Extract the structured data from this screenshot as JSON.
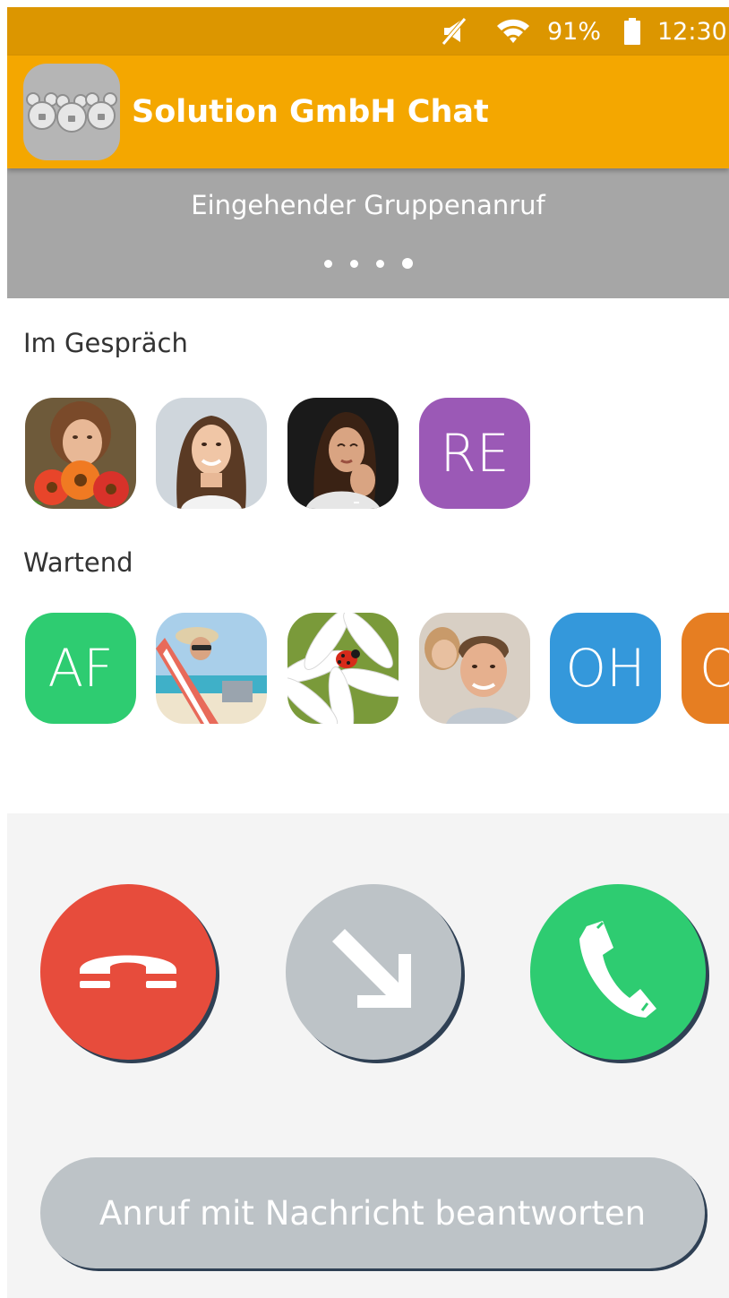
{
  "status_bar": {
    "battery": "91%",
    "time": "12:30",
    "icons": [
      "mute-icon",
      "wifi-icon",
      "battery-icon"
    ]
  },
  "app_bar": {
    "title": "Solution GmbH Chat",
    "logo_icon": "app-logo-icon"
  },
  "call": {
    "status": "Eingehender Gruppenanruf",
    "dots": 4
  },
  "in_call": {
    "label": "Im Gespräch",
    "participants": [
      {
        "type": "photo",
        "icon": "woman-with-flowers-photo"
      },
      {
        "type": "photo",
        "icon": "smiling-woman-photo"
      },
      {
        "type": "photo",
        "icon": "woman-thinking-photo"
      },
      {
        "type": "initials",
        "initials": "RE",
        "color": "#9b59b6"
      }
    ]
  },
  "waiting": {
    "label": "Wartend",
    "participants": [
      {
        "type": "initials",
        "initials": "AF",
        "color": "#2ecc71"
      },
      {
        "type": "photo",
        "icon": "beach-deckchair-photo"
      },
      {
        "type": "photo",
        "icon": "ladybug-daisy-photo"
      },
      {
        "type": "photo",
        "icon": "smiling-man-photo"
      },
      {
        "type": "initials",
        "initials": "OH",
        "color": "#3498db"
      },
      {
        "type": "initials",
        "initials": "O",
        "color": "#e67e22"
      }
    ]
  },
  "actions": {
    "decline": {
      "icon": "hang-up-icon",
      "color": "#e74c3c"
    },
    "forward": {
      "icon": "arrow-down-right-icon",
      "color": "#bdc3c7"
    },
    "accept": {
      "icon": "phone-icon",
      "color": "#2ecc71"
    },
    "reply_with_message": "Anruf mit Nachricht beantworten"
  },
  "colors": {
    "status_bar": "#dc9600",
    "app_bar": "#f4a700",
    "banner": "#a6a6a6",
    "panel": "#f4f4f4",
    "shadow": "#2f4054"
  }
}
